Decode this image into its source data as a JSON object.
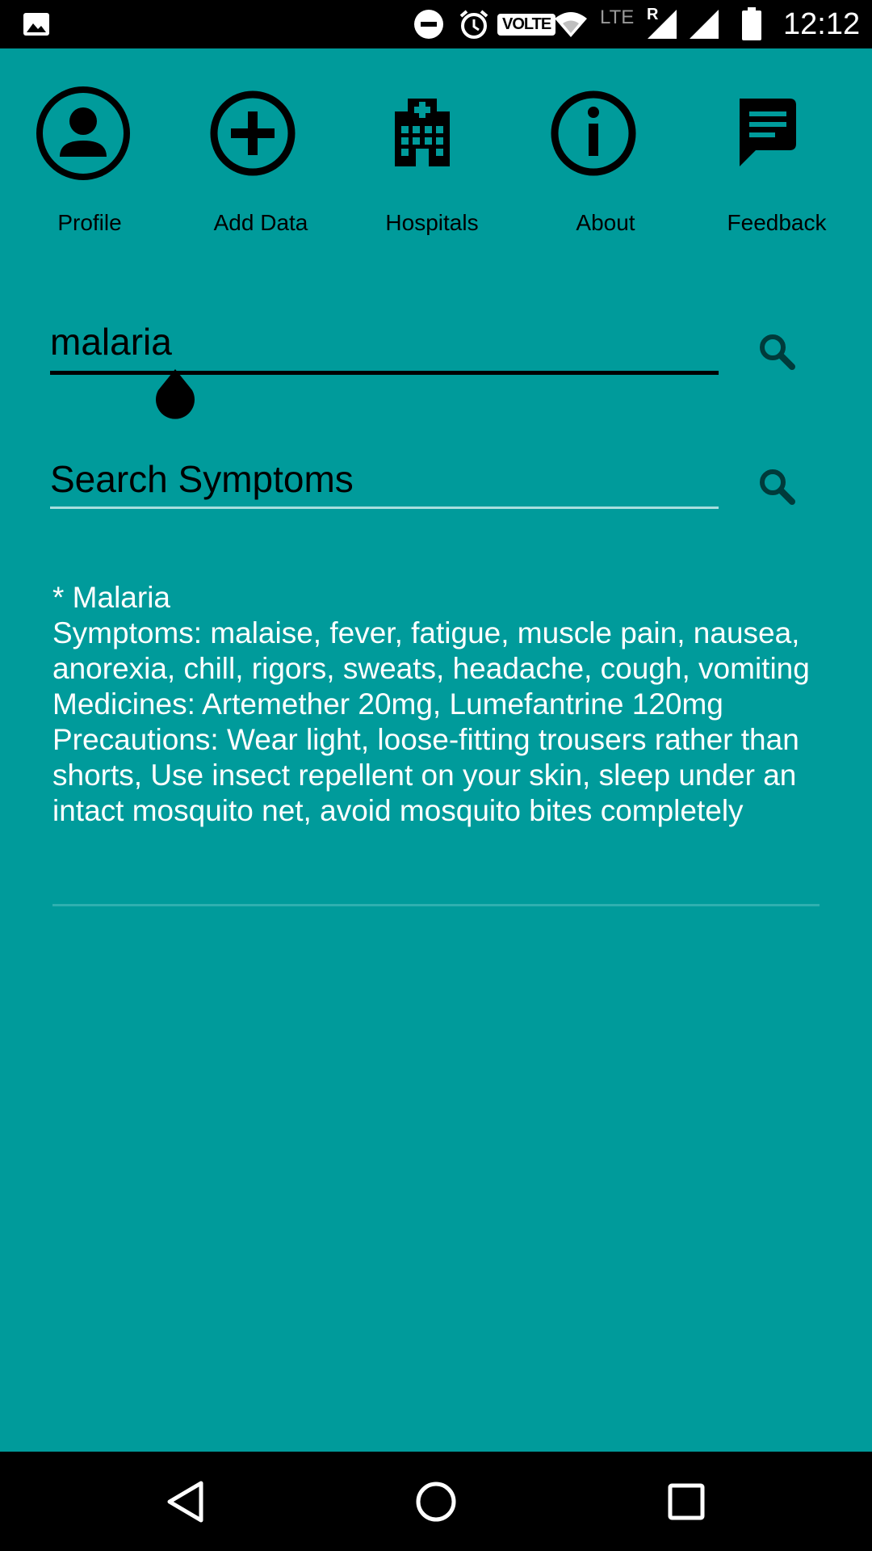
{
  "status_bar": {
    "time": "12:12",
    "volte": "VOLTE",
    "lte": "LTE",
    "roaming": "R",
    "icons": [
      "image-icon",
      "dnd-icon",
      "alarm-icon",
      "wifi-icon",
      "signal-icon",
      "signal-icon",
      "battery-icon"
    ]
  },
  "nav": {
    "items": [
      {
        "label": "Profile",
        "icon": "profile-icon"
      },
      {
        "label": "Add Data",
        "icon": "add-circle-icon"
      },
      {
        "label": "Hospitals",
        "icon": "hospital-icon"
      },
      {
        "label": "About",
        "icon": "info-icon"
      },
      {
        "label": "Feedback",
        "icon": "feedback-icon"
      }
    ]
  },
  "disease_search": {
    "value": "malaria"
  },
  "symptom_search": {
    "placeholder": "Search Symptoms"
  },
  "result": {
    "title": "* Malaria",
    "symptoms": "Symptoms: malaise,  fever,  fatigue,  muscle pain,  nausea,  anorexia,  chill,  rigors,  sweats,  headache,  cough,  vomiting",
    "medicines": "Medicines: Artemether 20mg,  Lumefantrine 120mg",
    "precautions": "Precautions: Wear light,  loose-fitting trousers rather than shorts, Use insect repellent on your skin,  sleep under an intact mosquito net,  avoid mosquito bites completely"
  },
  "colors": {
    "background": "#009b9b",
    "status_bar": "#000000",
    "result_text": "#ffffff"
  }
}
